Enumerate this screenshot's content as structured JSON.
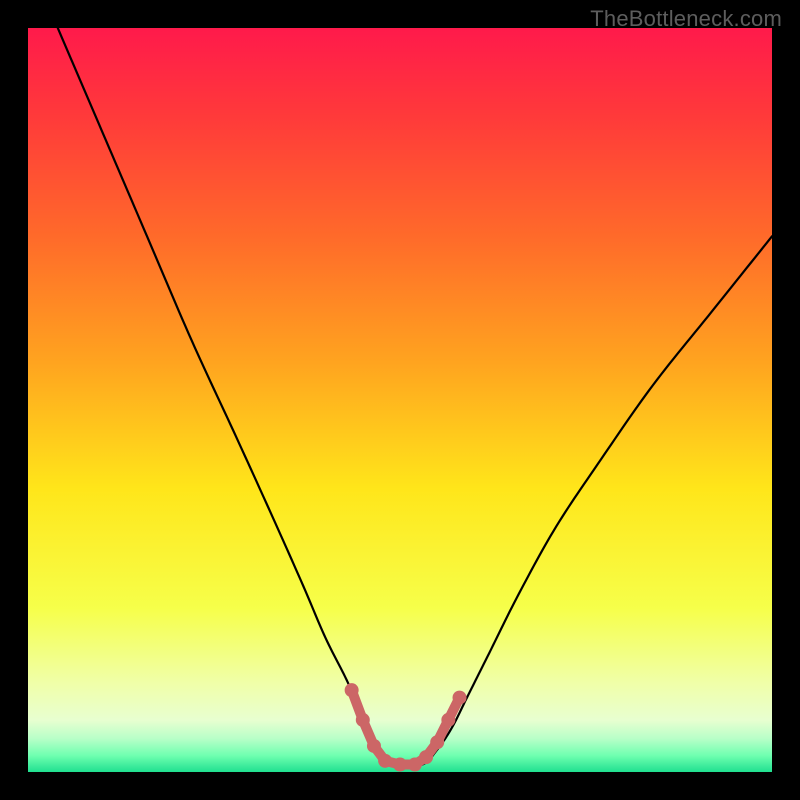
{
  "watermark": {
    "text": "TheBottleneck.com"
  },
  "chart_data": {
    "type": "line",
    "title": "",
    "xlabel": "",
    "ylabel": "",
    "xlim": [
      0,
      100
    ],
    "ylim": [
      0,
      100
    ],
    "background_gradient": {
      "stops": [
        {
          "offset": 0.0,
          "color": "#ff1a4b"
        },
        {
          "offset": 0.12,
          "color": "#ff3a3a"
        },
        {
          "offset": 0.28,
          "color": "#ff6a2a"
        },
        {
          "offset": 0.45,
          "color": "#ffa41f"
        },
        {
          "offset": 0.62,
          "color": "#ffe61a"
        },
        {
          "offset": 0.78,
          "color": "#f6ff4a"
        },
        {
          "offset": 0.88,
          "color": "#f0ffa8"
        },
        {
          "offset": 0.93,
          "color": "#e8ffd0"
        },
        {
          "offset": 0.955,
          "color": "#b8ffc8"
        },
        {
          "offset": 0.978,
          "color": "#6fffb0"
        },
        {
          "offset": 1.0,
          "color": "#20e090"
        }
      ]
    },
    "series": [
      {
        "name": "bottleneck-curve",
        "x": [
          4,
          10,
          16,
          22,
          28,
          33,
          37,
          40,
          43,
          45,
          47,
          50,
          53,
          55,
          57,
          59,
          62,
          66,
          71,
          77,
          84,
          92,
          100
        ],
        "y": [
          100,
          86,
          72,
          58,
          45,
          34,
          25,
          18,
          12,
          7,
          3,
          1,
          1,
          3,
          6,
          10,
          16,
          24,
          33,
          42,
          52,
          62,
          72
        ]
      }
    ],
    "markers": {
      "name": "optimal-range",
      "x": [
        43.5,
        45.0,
        46.5,
        48.0,
        50.0,
        52.0,
        53.5,
        55.0,
        56.5,
        58.0
      ],
      "y": [
        11.0,
        7.0,
        3.5,
        1.5,
        1.0,
        1.0,
        2.0,
        4.0,
        7.0,
        10.0
      ]
    },
    "curve_color": "#000000",
    "marker_color": "#cc6666"
  }
}
